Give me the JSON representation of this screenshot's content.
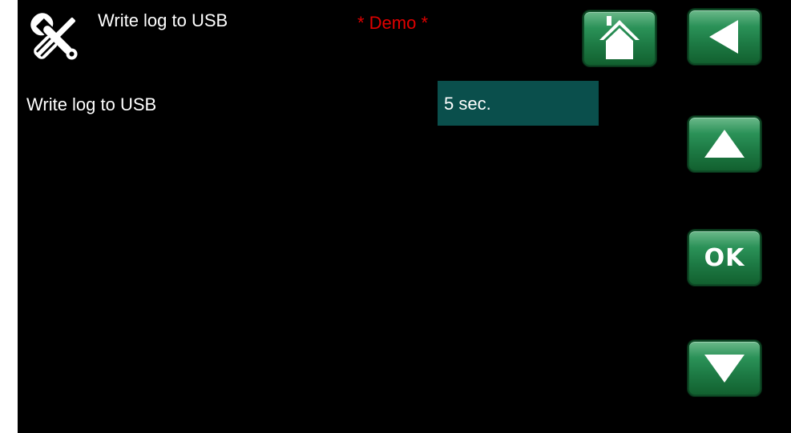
{
  "header": {
    "title": "Write log to USB",
    "demo_label": "* Demo *",
    "icon": "tools-icon"
  },
  "setting": {
    "label": "Write log to USB",
    "value": "5 sec."
  },
  "buttons": {
    "home": {
      "icon": "home-icon"
    },
    "back": {
      "icon": "back-arrow-icon"
    },
    "up": {
      "icon": "up-arrow-icon"
    },
    "ok": {
      "label": "OK"
    },
    "down": {
      "icon": "down-arrow-icon"
    }
  },
  "colors": {
    "background": "#000000",
    "demo_text": "#e00000",
    "value_field": "#0a4f4c",
    "button_green": "#1d7a44"
  }
}
